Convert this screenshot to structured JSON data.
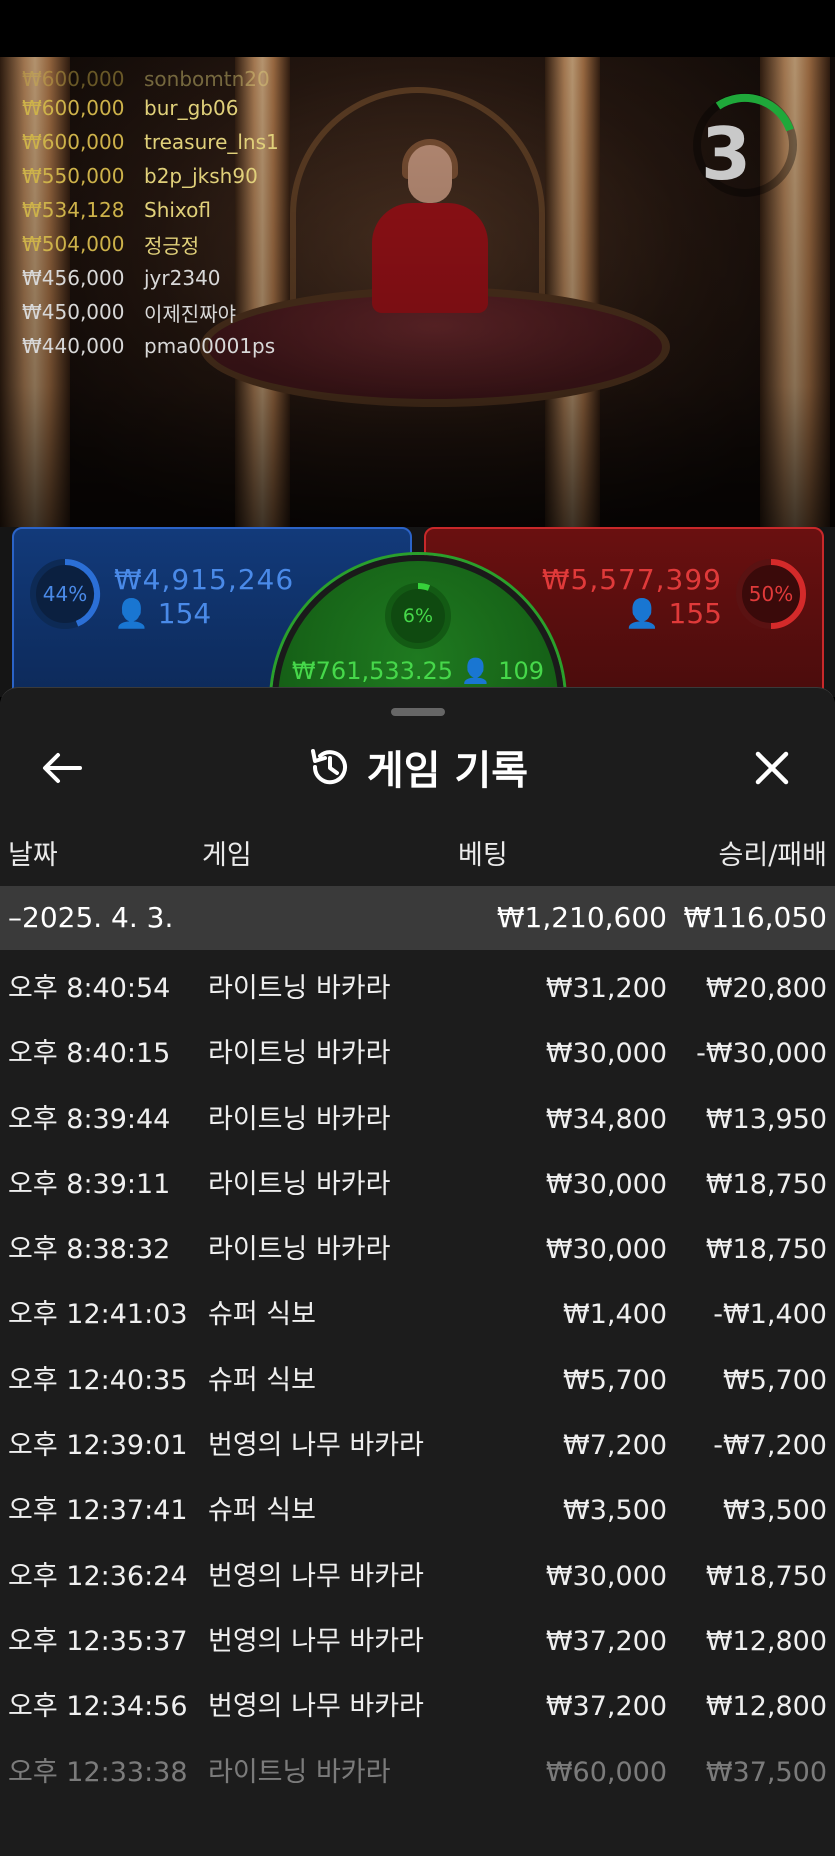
{
  "timer": {
    "value": "3"
  },
  "leaderboard": [
    {
      "amount": "₩600,000",
      "name": "bur_gb06"
    },
    {
      "amount": "₩600,000",
      "name": "treasure_lns1"
    },
    {
      "amount": "₩550,000",
      "name": "b2p_jksh90"
    },
    {
      "amount": "₩534,128",
      "name": "Shixofl"
    },
    {
      "amount": "₩504,000",
      "name": "정긍정"
    },
    {
      "amount": "₩456,000",
      "name": "jyr2340"
    },
    {
      "amount": "₩450,000",
      "name": "이제진짜야"
    },
    {
      "amount": "₩440,000",
      "name": "pma00001ps"
    }
  ],
  "leaderboard_partial": {
    "amount": "₩600,000",
    "name": "sonbomtn20"
  },
  "bets": {
    "player": {
      "percent": "44%",
      "amount": "₩4,915,246",
      "count": "154",
      "color": "#2b6fd6"
    },
    "banker": {
      "percent": "50%",
      "amount": "₩5,577,399",
      "count": "155",
      "color": "#d42a2a"
    },
    "tie": {
      "percent": "6%",
      "amount": "₩761,533.25",
      "count": "109",
      "color": "#2aa02c"
    }
  },
  "history": {
    "title": "게임 기록",
    "columns": {
      "date": "날짜",
      "game": "게임",
      "bet": "베팅",
      "winloss": "승리/패배"
    },
    "group": {
      "label": "–2025. 4. 3.",
      "bet": "₩1,210,600",
      "winloss": "₩116,050"
    },
    "rows": [
      {
        "time": "오후 8:40:54",
        "game": "라이트닝 바카라",
        "bet": "₩31,200",
        "winloss": "₩20,800"
      },
      {
        "time": "오후 8:40:15",
        "game": "라이트닝 바카라",
        "bet": "₩30,000",
        "winloss": "-₩30,000"
      },
      {
        "time": "오후 8:39:44",
        "game": "라이트닝 바카라",
        "bet": "₩34,800",
        "winloss": "₩13,950"
      },
      {
        "time": "오후 8:39:11",
        "game": "라이트닝 바카라",
        "bet": "₩30,000",
        "winloss": "₩18,750"
      },
      {
        "time": "오후 8:38:32",
        "game": "라이트닝 바카라",
        "bet": "₩30,000",
        "winloss": "₩18,750"
      },
      {
        "time": "오후 12:41:03",
        "game": "슈퍼 식보",
        "bet": "₩1,400",
        "winloss": "-₩1,400"
      },
      {
        "time": "오후 12:40:35",
        "game": "슈퍼 식보",
        "bet": "₩5,700",
        "winloss": "₩5,700"
      },
      {
        "time": "오후 12:39:01",
        "game": "번영의 나무 바카라",
        "bet": "₩7,200",
        "winloss": "-₩7,200"
      },
      {
        "time": "오후 12:37:41",
        "game": "슈퍼 식보",
        "bet": "₩3,500",
        "winloss": "₩3,500"
      },
      {
        "time": "오후 12:36:24",
        "game": "번영의 나무 바카라",
        "bet": "₩30,000",
        "winloss": "₩18,750"
      },
      {
        "time": "오후 12:35:37",
        "game": "번영의 나무 바카라",
        "bet": "₩37,200",
        "winloss": "₩12,800"
      },
      {
        "time": "오후 12:34:56",
        "game": "번영의 나무 바카라",
        "bet": "₩37,200",
        "winloss": "₩12,800"
      },
      {
        "time": "오후 12:33:38",
        "game": "라이트닝 바카라",
        "bet": "₩60,000",
        "winloss": "₩37,500"
      }
    ]
  }
}
